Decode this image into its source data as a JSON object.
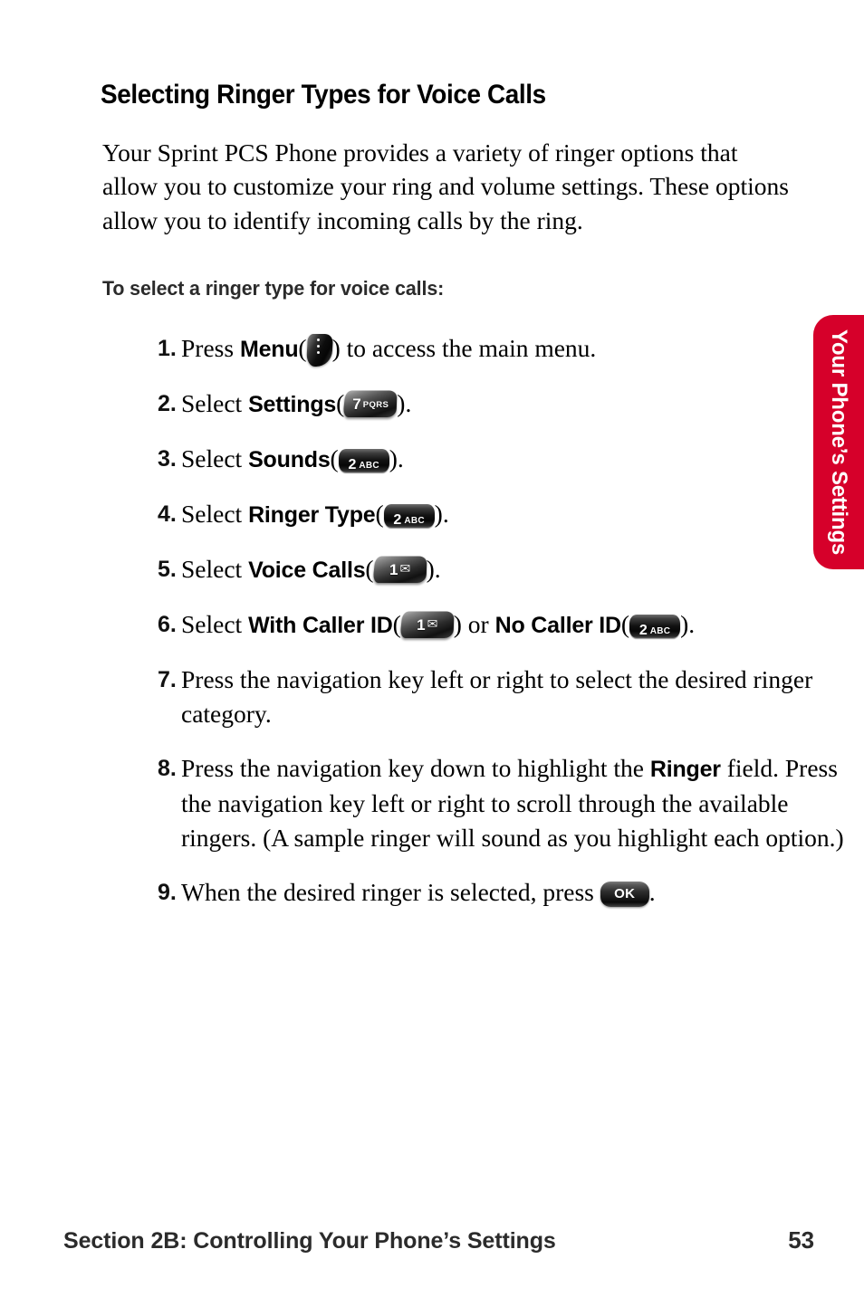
{
  "document": {
    "heading": "Selecting Ringer Types for Voice Calls",
    "intro_paragraph": "Your Sprint PCS Phone provides a variety of ringer options that allow you to customize your ring and volume settings. These options allow you to identify incoming calls by the ring.",
    "sub_heading": "To select a ringer type for voice calls:"
  },
  "steps": [
    {
      "number": "1.",
      "text_before": "Press ",
      "bold_1": "Menu",
      "paren_open": "(",
      "key": {
        "type": "menu",
        "digit": "",
        "letters": "",
        "name": "menu-key"
      },
      "paren_close": ")",
      "text_after": " to access the main menu."
    },
    {
      "number": "2.",
      "text_before": "Select ",
      "bold_1": "Settings",
      "paren_open": "(",
      "key": {
        "type": "slant",
        "digit": "7",
        "letters": "PQRS",
        "name": "key-7-pqrs"
      },
      "paren_close": ")",
      "text_after": "."
    },
    {
      "number": "3.",
      "text_before": "Select ",
      "bold_1": "Sounds",
      "paren_open": "(",
      "key": {
        "type": "rect",
        "digit": "2",
        "letters": "ABC",
        "name": "key-2-abc"
      },
      "paren_close": ")",
      "text_after": "."
    },
    {
      "number": "4.",
      "text_before": "Select ",
      "bold_1": "Ringer Type",
      "paren_open": "(",
      "key": {
        "type": "rect",
        "digit": "2",
        "letters": "ABC",
        "name": "key-2-abc"
      },
      "paren_close": ")",
      "text_after": "."
    },
    {
      "number": "5.",
      "text_before": "Select ",
      "bold_1": "Voice Calls",
      "paren_open": "(",
      "key": {
        "type": "slant",
        "digit": "1",
        "letters": "envelope",
        "name": "key-1-voicemail"
      },
      "paren_close": ")",
      "text_after": "."
    },
    {
      "number": "6.",
      "text_before": "Select ",
      "bold_1": "With Caller ID",
      "paren_open": "(",
      "key": {
        "type": "slant",
        "digit": "1",
        "letters": "envelope",
        "name": "key-1-voicemail"
      },
      "paren_close": ")",
      "text_mid": " or ",
      "bold_2": "No Caller ID",
      "paren_open_2": "(",
      "key2": {
        "type": "rect",
        "digit": "2",
        "letters": "ABC",
        "name": "key-2-abc"
      },
      "paren_close_2": ")",
      "text_after": "."
    },
    {
      "number": "7.",
      "text_before": "Press the navigation key left or right to select the desired ringer category.",
      "bold_1": "",
      "text_after": ""
    },
    {
      "number": "8.",
      "text_before": "Press the navigation key down to highlight the ",
      "bold_1": "Ringer",
      "text_after": " field. Press the navigation key left or right to scroll through the available ringers. (A sample ringer will sound as you highlight each option.)"
    },
    {
      "number": "9.",
      "text_before": "When the desired ringer is selected, press ",
      "key": {
        "type": "ok",
        "label": "OK",
        "name": "ok-key"
      },
      "text_after": "."
    }
  ],
  "side_tab": {
    "label": "Your Phone’s Settings",
    "color": "#d6002a"
  },
  "footer": {
    "section": "Section 2B: Controlling Your Phone’s Settings",
    "page_number": "53"
  }
}
